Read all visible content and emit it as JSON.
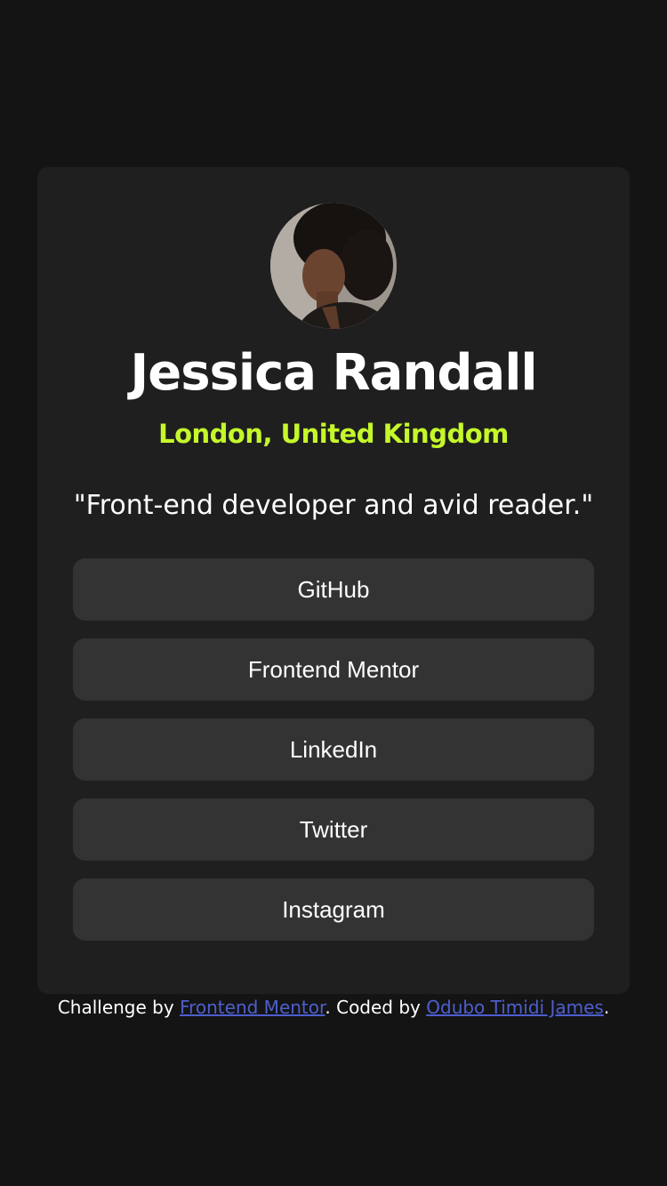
{
  "profile": {
    "name": "Jessica Randall",
    "location": "London, United Kingdom",
    "bio": "\"Front-end developer and avid reader.\""
  },
  "links": [
    {
      "label": "GitHub"
    },
    {
      "label": "Frontend Mentor"
    },
    {
      "label": "LinkedIn"
    },
    {
      "label": "Twitter"
    },
    {
      "label": "Instagram"
    }
  ],
  "footer": {
    "prefix": "Challenge by ",
    "challenge_link": "Frontend Mentor",
    "middle": ". Coded by ",
    "author_link": "Odubo Timidi James",
    "suffix": "."
  },
  "colors": {
    "page_background": "#141414",
    "card_background": "#1f1f1f",
    "button_background": "#333333",
    "accent": "#c4f82a",
    "link": "#4d5fcf"
  }
}
